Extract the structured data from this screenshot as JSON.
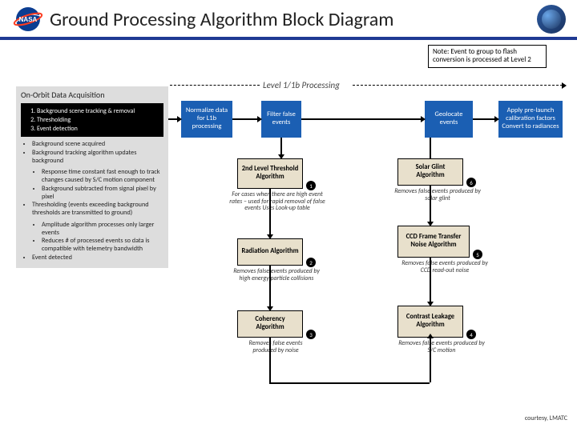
{
  "header": {
    "title": "Ground Processing Algorithm Block Diagram"
  },
  "note": "Note: Event to group to flash conversion is processed at Level 2",
  "sectionLabel": "Level 1/1b Processing",
  "onorbit": {
    "title": "On-Orbit Data Acquisition",
    "step1": "Background scene tracking & removal",
    "step2": "Thresholding",
    "step3": "Event detection",
    "b1": "Background scene acquired",
    "b2": "Background tracking algorithm updates background",
    "b2a": "Response time constant fast enough to track changes caused by S/C motion component",
    "b2b": "Background subtracted from signal pixel by pixel",
    "b3": "Thresholding (events exceeding background thresholds are transmitted to ground)",
    "b3a": "Amplitude algorithm processes only larger events",
    "b3b": "Reduces # of processed events so data is compatible with telemetry bandwidth",
    "b4": "Event detected"
  },
  "boxes": {
    "normalize": "Normalize data for L1b processing",
    "filter": "Filter false events",
    "geolocate": "Geolocate events",
    "calibrate": "Apply pre-launch calibration factors Convert to radiances",
    "threshold2": "2nd Level Threshold Algorithm",
    "radiation": "Radiation Algorithm",
    "coherency": "Coherency Algorithm",
    "glint": "Solar Glint Algorithm",
    "ccd": "CCD Frame Transfer Noise Algorithm",
    "contrast": "Contrast Leakage Algorithm"
  },
  "captions": {
    "threshold2": "For cases when there are high event rates – used for rapid removal of false events Uses Look-up table",
    "radiation": "Removes false events produced by high energy particle collisions",
    "coherency": "Removes false events produced by noise",
    "glint": "Removes false events produced by solar glint",
    "ccd": "Removes false events produced by CCD read-out noise",
    "contrast": "Removes false events produced by S/C motion"
  },
  "badges": {
    "n1": "1",
    "n2": "2",
    "n3": "3",
    "n4": "4",
    "n5": "5",
    "n6": "6"
  },
  "courtesy": "courtesy, LMATC"
}
